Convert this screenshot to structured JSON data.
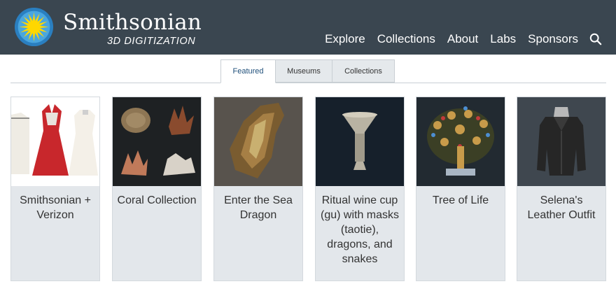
{
  "brand": {
    "title": "Smithsonian",
    "subtitle": "3D DIGITIZATION"
  },
  "nav": {
    "items": [
      "Explore",
      "Collections",
      "About",
      "Labs",
      "Sponsors"
    ]
  },
  "tabs": [
    "Featured",
    "Museums",
    "Collections"
  ],
  "cards": [
    {
      "title": "Smithsonian + Verizon"
    },
    {
      "title": "Coral Collection"
    },
    {
      "title": "Enter the Sea Dragon"
    },
    {
      "title": "Ritual wine cup (gu) with masks (taotie), dragons, and snakes"
    },
    {
      "title": "Tree of Life"
    },
    {
      "title": "Selena's Leather Outfit"
    }
  ],
  "colors": {
    "header": "#3a4650",
    "card": "#e3e7eb",
    "active_tab_text": "#1f4f7a",
    "sun": "#ffd700",
    "sun_ring": "#2a7fc0"
  }
}
